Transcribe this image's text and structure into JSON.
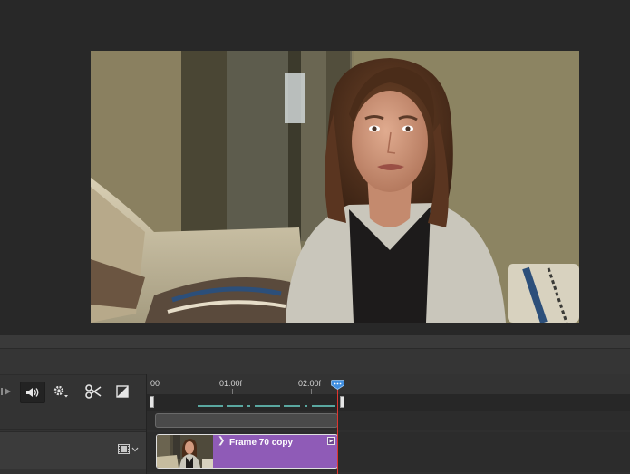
{
  "timeline": {
    "ruler": {
      "labels": [
        "00",
        "01:00f",
        "02:00f"
      ]
    },
    "video_clip": {
      "name": "Frame 70 copy",
      "color": "#8f5bb7"
    },
    "playhead_color": "#e0352f",
    "controls": {
      "play": "play-icon",
      "audio": "speaker-icon",
      "settings": "gear-icon",
      "split": "scissors-icon",
      "transition": "transition-icon"
    }
  }
}
